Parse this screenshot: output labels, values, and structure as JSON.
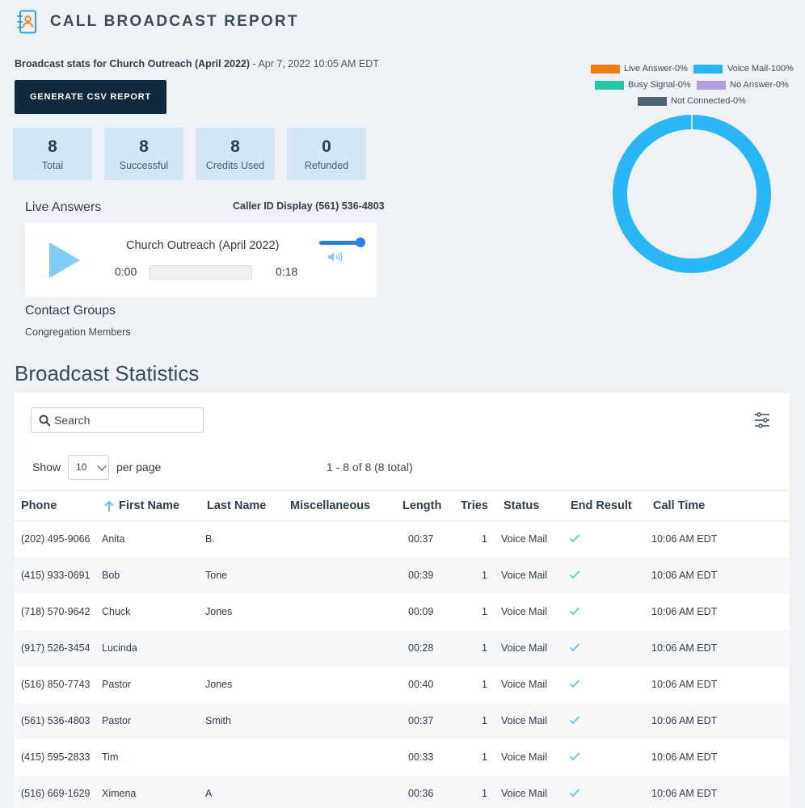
{
  "header": {
    "title": "CALL BROADCAST REPORT",
    "icon": "contact-book-icon"
  },
  "subtitle": {
    "bold": "Broadcast stats for Church Outreach (April 2022)",
    "rest": " - Apr 7, 2022 10:05 AM EDT"
  },
  "csv_button": "GENERATE CSV REPORT",
  "stats": [
    {
      "value": "8",
      "label": "Total"
    },
    {
      "value": "8",
      "label": "Successful"
    },
    {
      "value": "8",
      "label": "Credits Used"
    },
    {
      "value": "0",
      "label": "Refunded"
    }
  ],
  "live_answers": {
    "title": "Live Answers",
    "caller_id_label": "Caller ID Display",
    "caller_id_value": "(561) 536-4803"
  },
  "player": {
    "track_title": "Church Outreach (April 2022)",
    "current_time": "0:00",
    "duration": "0:18",
    "progress": 0.0,
    "volume": 1.0
  },
  "contact_groups": {
    "title": "Contact Groups",
    "items": [
      "Congregation Members"
    ]
  },
  "legend": [
    {
      "label": "Live Answer-0%",
      "color": "#f57c14"
    },
    {
      "label": "Voice Mail-100%",
      "color": "#29b6f6"
    },
    {
      "label": "Busy Signal-0%",
      "color": "#26c6a6"
    },
    {
      "label": "No Answer-0%",
      "color": "#b39ddb"
    },
    {
      "label": "Not Connected-0%",
      "color": "#4e6470"
    }
  ],
  "chart_data": {
    "type": "pie",
    "categories": [
      "Live Answer",
      "Voice Mail",
      "Busy Signal",
      "No Answer",
      "Not Connected"
    ],
    "values": [
      0,
      100,
      0,
      0,
      0
    ],
    "colors": [
      "#f57c14",
      "#29b6f6",
      "#26c6a6",
      "#b39ddb",
      "#4e6470"
    ],
    "donut": true,
    "legend": "top"
  },
  "statistics": {
    "title": "Broadcast Statistics",
    "search_placeholder": "Search",
    "show_label": "Show",
    "per_page_value": "10",
    "per_page_label": "per page",
    "range_label": "1 - 8 of 8 (8 total)",
    "columns": [
      "Phone",
      "First Name",
      "Last Name",
      "Miscellaneous",
      "Length",
      "Tries",
      "Status",
      "End Result",
      "Call Time"
    ],
    "rows": [
      {
        "phone": "(202) 495-9066",
        "first": "Anita",
        "last": "B.",
        "misc": "",
        "length": "00:37",
        "tries": "1",
        "status": "Voice Mail",
        "time": "10:06 AM EDT"
      },
      {
        "phone": "(415) 933-0691",
        "first": "Bob",
        "last": "Tone",
        "misc": "",
        "length": "00:39",
        "tries": "1",
        "status": "Voice Mail",
        "time": "10:06 AM EDT"
      },
      {
        "phone": "(718) 570-9642",
        "first": "Chuck",
        "last": "Jones",
        "misc": "",
        "length": "00:09",
        "tries": "1",
        "status": "Voice Mail",
        "time": "10:06 AM EDT"
      },
      {
        "phone": "(917) 526-3454",
        "first": "Lucinda",
        "last": "",
        "misc": "",
        "length": "00:28",
        "tries": "1",
        "status": "Voice Mail",
        "time": "10:06 AM EDT"
      },
      {
        "phone": "(516) 850-7743",
        "first": "Pastor",
        "last": "Jones",
        "misc": "",
        "length": "00:40",
        "tries": "1",
        "status": "Voice Mail",
        "time": "10:06 AM EDT"
      },
      {
        "phone": "(561) 536-4803",
        "first": "Pastor",
        "last": "Smith",
        "misc": "",
        "length": "00:37",
        "tries": "1",
        "status": "Voice Mail",
        "time": "10:06 AM EDT"
      },
      {
        "phone": "(415) 595-2833",
        "first": "Tim",
        "last": "",
        "misc": "",
        "length": "00:33",
        "tries": "1",
        "status": "Voice Mail",
        "time": "10:06 AM EDT"
      },
      {
        "phone": "(516) 669-1629",
        "first": "Ximena",
        "last": "A",
        "misc": "",
        "length": "00:36",
        "tries": "1",
        "status": "Voice Mail",
        "time": "10:06 AM EDT"
      }
    ]
  }
}
